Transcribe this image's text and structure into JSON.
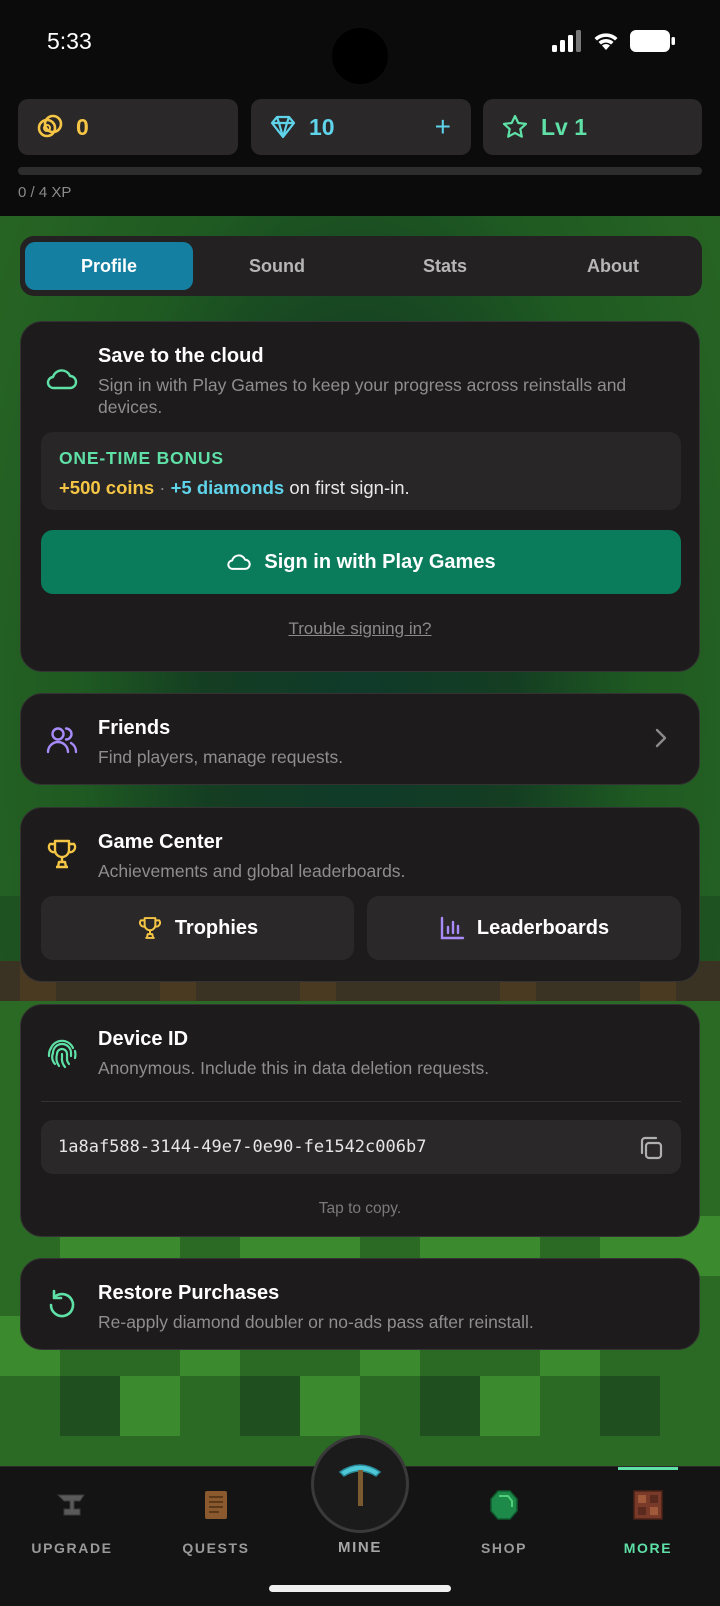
{
  "status_bar": {
    "time": "5:33"
  },
  "currency": {
    "coins": "0",
    "diamonds": "10",
    "plus": "+",
    "level": "Lv 1",
    "xp_text": "0 / 4 XP",
    "xp_progress": 0
  },
  "tabs": [
    {
      "label": "Profile",
      "active": true
    },
    {
      "label": "Sound",
      "active": false
    },
    {
      "label": "Stats",
      "active": false
    },
    {
      "label": "About",
      "active": false
    }
  ],
  "cloud": {
    "title": "Save to the cloud",
    "subtitle_line1": "Sign in with Play Games to keep your progress across reinstalls and",
    "subtitle_line2": "devices.",
    "bonus_label": "ONE-TIME BONUS",
    "bonus_coins": "+500 coins",
    "bonus_sep": " · ",
    "bonus_diamonds": "+5 diamonds",
    "bonus_tail": " on first sign-in.",
    "signin_button": "Sign in with Play Games",
    "trouble_link": "Trouble signing in?"
  },
  "friends": {
    "title": "Friends",
    "subtitle": "Find players, manage requests."
  },
  "game_center": {
    "title": "Game Center",
    "subtitle": "Achievements and global leaderboards.",
    "trophies_button": "Trophies",
    "leaderboards_button": "Leaderboards"
  },
  "device": {
    "title": "Device ID",
    "subtitle": "Anonymous. Include this in data deletion requests.",
    "id": "1a8af588-3144-49e7-0e90-fe1542c006b7",
    "hint": "Tap to copy."
  },
  "restore": {
    "title": "Restore Purchases",
    "subtitle": "Re-apply diamond doubler or no-ads pass after reinstall."
  },
  "nav": {
    "upgrade": "UPGRADE",
    "quests": "QUESTS",
    "mine": "MINE",
    "shop": "SHOP",
    "more": "MORE",
    "active": "more"
  },
  "colors": {
    "accent_green": "#5ee0a7",
    "coin_gold": "#f5c545",
    "diamond_cyan": "#5fd3ea",
    "tab_active": "#157fa1",
    "signin_green": "#0a7c5c",
    "friends_purple": "#a78bfa"
  },
  "icons": [
    "coins-icon",
    "diamond-icon",
    "star-icon",
    "cloud-icon",
    "users-icon",
    "chevron-right-icon",
    "trophy-icon",
    "bar-chart-icon",
    "fingerprint-icon",
    "copy-icon",
    "restore-icon",
    "anvil-icon",
    "scroll-icon",
    "pickaxe-icon",
    "emerald-icon",
    "crate-icon"
  ]
}
